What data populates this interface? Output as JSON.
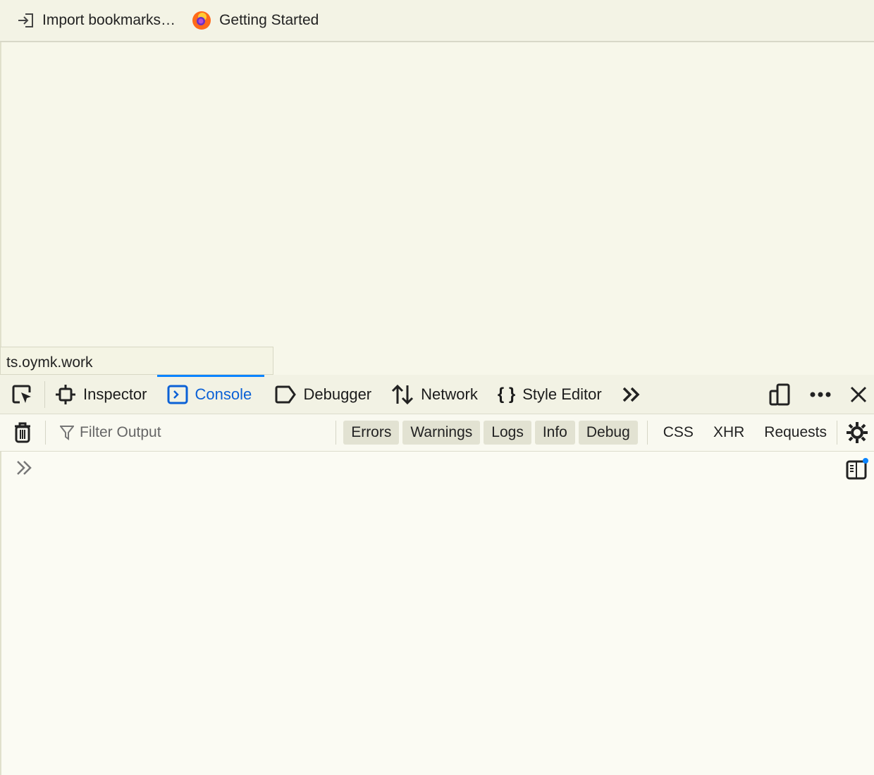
{
  "bookmarks": [
    {
      "label": "Import bookmarks…",
      "icon": "import-icon"
    },
    {
      "label": "Getting Started",
      "icon": "firefox-icon"
    }
  ],
  "status_url": "ts.oymk.work",
  "devtools": {
    "tabs": [
      {
        "label": "Inspector",
        "icon": "inspector-icon"
      },
      {
        "label": "Console",
        "icon": "console-icon",
        "selected": true
      },
      {
        "label": "Debugger",
        "icon": "debugger-icon"
      },
      {
        "label": "Network",
        "icon": "network-icon"
      },
      {
        "label": "Style Editor",
        "icon": "style-editor-icon"
      }
    ],
    "filter_placeholder": "Filter Output",
    "level_filters": [
      "Errors",
      "Warnings",
      "Logs",
      "Info",
      "Debug"
    ],
    "extra_filters": [
      "CSS",
      "XHR",
      "Requests"
    ],
    "accent": "#0a84ff"
  }
}
